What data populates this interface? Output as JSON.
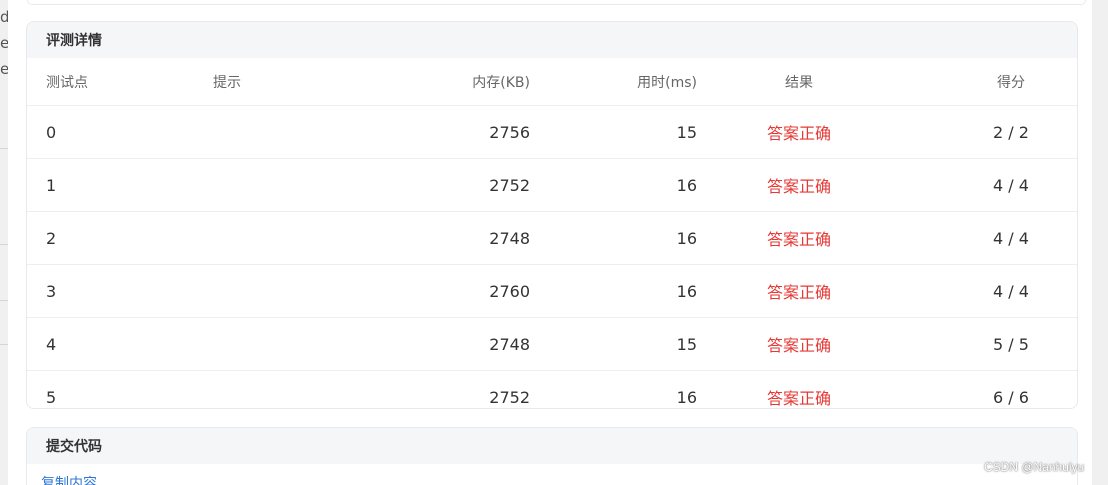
{
  "background": {
    "fragments": [
      "d",
      "e",
      "e"
    ]
  },
  "details": {
    "title": "评测详情",
    "columns": {
      "id": "测试点",
      "hint": "提示",
      "memory": "内存(KB)",
      "time": "用时(ms)",
      "result": "结果",
      "score": "得分"
    },
    "rows": [
      {
        "id": "0",
        "hint": "",
        "memory": "2756",
        "time": "15",
        "result": "答案正确",
        "score": "2 / 2"
      },
      {
        "id": "1",
        "hint": "",
        "memory": "2752",
        "time": "16",
        "result": "答案正确",
        "score": "4 / 4"
      },
      {
        "id": "2",
        "hint": "",
        "memory": "2748",
        "time": "16",
        "result": "答案正确",
        "score": "4 / 4"
      },
      {
        "id": "3",
        "hint": "",
        "memory": "2760",
        "time": "16",
        "result": "答案正确",
        "score": "4 / 4"
      },
      {
        "id": "4",
        "hint": "",
        "memory": "2748",
        "time": "15",
        "result": "答案正确",
        "score": "5 / 5"
      },
      {
        "id": "5",
        "hint": "",
        "memory": "2752",
        "time": "16",
        "result": "答案正确",
        "score": "6 / 6"
      }
    ]
  },
  "code": {
    "title": "提交代码",
    "copy_label": "复制内容"
  },
  "watermark": "CSDN @Nanhuiyu",
  "colors": {
    "accepted": "#e53935",
    "link": "#2f77d6"
  }
}
